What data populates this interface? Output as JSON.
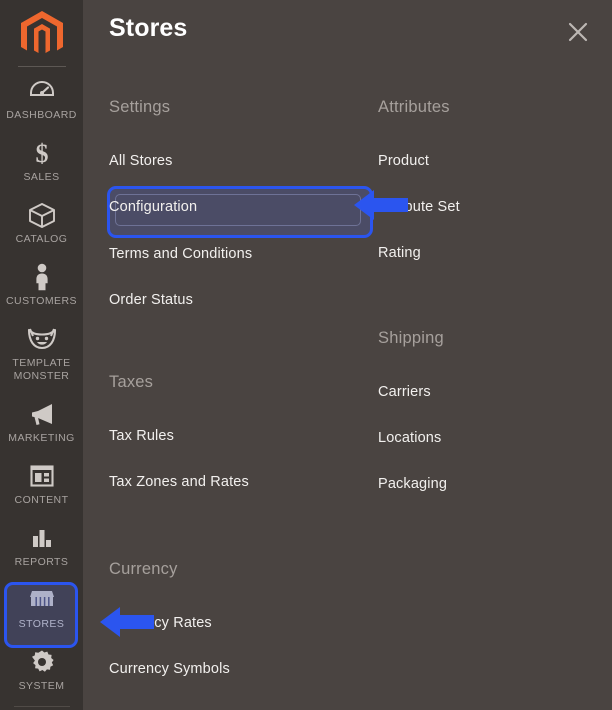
{
  "colors": {
    "sidebar_bg": "#373330",
    "panel_bg": "#4a4441",
    "accent_blue": "#2b55ef",
    "logo_orange": "#ee672e",
    "label_grey": "#a8a3a0",
    "link_white": "#f2f0ee"
  },
  "sidebar": {
    "logo_name": "magento-logo",
    "items": [
      {
        "label": "Dashboard",
        "icon": "gauge-icon",
        "active": false
      },
      {
        "label": "Sales",
        "icon": "dollar-icon",
        "active": false
      },
      {
        "label": "Catalog",
        "icon": "box-icon",
        "active": false
      },
      {
        "label": "Customers",
        "icon": "person-icon",
        "active": false
      },
      {
        "label": "Template\nMonster",
        "icon": "monster-icon",
        "active": false
      },
      {
        "label": "Marketing",
        "icon": "megaphone-icon",
        "active": false
      },
      {
        "label": "Content",
        "icon": "layout-icon",
        "active": false
      },
      {
        "label": "Reports",
        "icon": "bar-chart-icon",
        "active": false
      },
      {
        "label": "Stores",
        "icon": "storefront-icon",
        "active": true
      },
      {
        "label": "System",
        "icon": "gear-icon",
        "active": false
      }
    ]
  },
  "header": {
    "title": "Stores",
    "close_icon": "close-icon"
  },
  "menu": {
    "groups": [
      {
        "title": "Settings",
        "column": "left",
        "links": [
          "All Stores",
          "Configuration",
          "Terms and Conditions",
          "Order Status"
        ]
      },
      {
        "title": "Attributes",
        "column": "right",
        "links": [
          "Product",
          "Attribute Set",
          "Rating"
        ]
      },
      {
        "title": "Taxes",
        "column": "left",
        "links": [
          "Tax Rules",
          "Tax Zones and Rates"
        ]
      },
      {
        "title": "Shipping",
        "column": "right",
        "links": [
          "Carriers",
          "Locations",
          "Packaging"
        ]
      },
      {
        "title": "Currency",
        "column": "left",
        "links": [
          "Currency Rates",
          "Currency Symbols"
        ]
      }
    ]
  },
  "annotations": {
    "highlight_target": "Configuration",
    "arrows": [
      {
        "name": "arrow-configuration",
        "points_to": "Configuration"
      },
      {
        "name": "arrow-currency-rates",
        "points_to": "Currency Rates"
      },
      {
        "name": "arrow-stores-sidebar",
        "points_to": "Stores"
      }
    ]
  }
}
